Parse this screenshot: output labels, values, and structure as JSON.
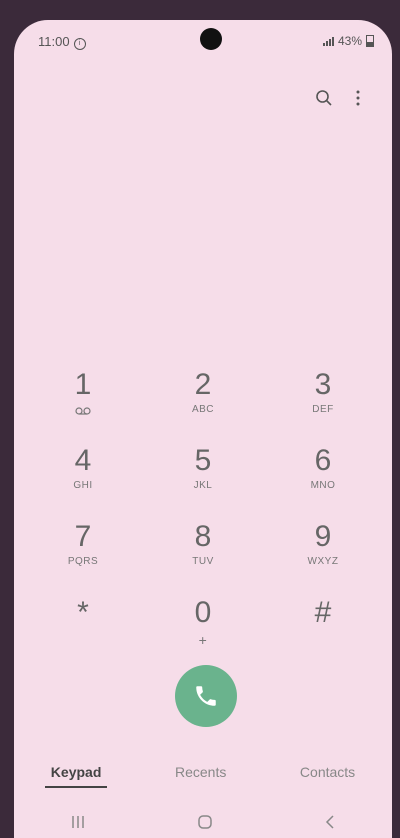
{
  "status": {
    "time": "11:00",
    "battery": "43%"
  },
  "dialpad": {
    "keys": [
      {
        "digit": "1",
        "letters": ""
      },
      {
        "digit": "2",
        "letters": "ABC"
      },
      {
        "digit": "3",
        "letters": "DEF"
      },
      {
        "digit": "4",
        "letters": "GHI"
      },
      {
        "digit": "5",
        "letters": "JKL"
      },
      {
        "digit": "6",
        "letters": "MNO"
      },
      {
        "digit": "7",
        "letters": "PQRS"
      },
      {
        "digit": "8",
        "letters": "TUV"
      },
      {
        "digit": "9",
        "letters": "WXYZ"
      },
      {
        "digit": "*",
        "letters": ""
      },
      {
        "digit": "0",
        "letters": "+"
      },
      {
        "digit": "#",
        "letters": ""
      }
    ]
  },
  "tabs": {
    "keypad": "Keypad",
    "recents": "Recents",
    "contacts": "Contacts"
  },
  "icons": {
    "search": "search-icon",
    "more": "more-vertical-icon",
    "call": "phone-icon",
    "voicemail": "voicemail-icon"
  },
  "colors": {
    "call_button": "#6ab38d",
    "background": "#f6dde9"
  }
}
